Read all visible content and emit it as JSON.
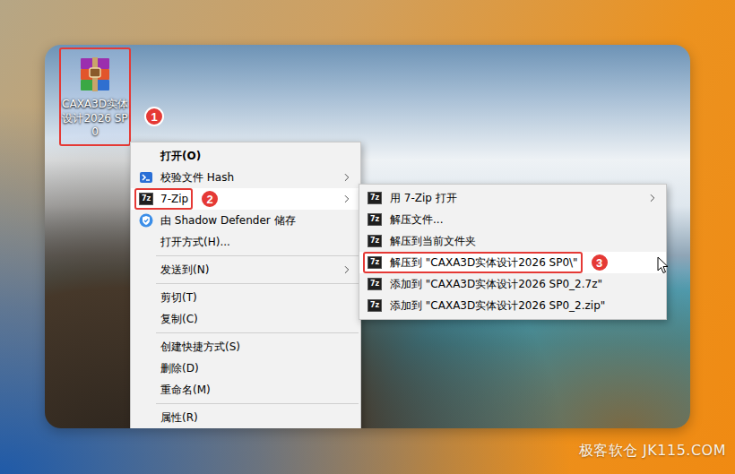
{
  "desktop": {
    "icon": {
      "label": "CAXA3D实体设计2026 SP0",
      "selected": true,
      "marked": true,
      "badge": "1"
    }
  },
  "context_menu": {
    "items": [
      {
        "label": "打开(O)",
        "kind": "plain",
        "bold": true,
        "submenu": false,
        "selected": false,
        "marked": false
      },
      {
        "label": "校验文件 Hash",
        "kind": "hash",
        "bold": false,
        "submenu": true,
        "selected": false,
        "marked": false
      },
      {
        "label": "7-Zip",
        "kind": "zip",
        "bold": false,
        "submenu": true,
        "selected": true,
        "marked": true,
        "badge": "2"
      },
      {
        "label": "由 Shadow Defender 储存",
        "kind": "shield",
        "bold": false,
        "submenu": false,
        "selected": false,
        "marked": false
      },
      {
        "label": "打开方式(H)...",
        "kind": "plain",
        "bold": false,
        "submenu": false,
        "selected": false,
        "marked": false
      },
      {
        "kind": "separator"
      },
      {
        "label": "发送到(N)",
        "kind": "plain",
        "bold": false,
        "submenu": true,
        "selected": false,
        "marked": false
      },
      {
        "kind": "separator"
      },
      {
        "label": "剪切(T)",
        "kind": "plain",
        "bold": false,
        "submenu": false,
        "selected": false,
        "marked": false
      },
      {
        "label": "复制(C)",
        "kind": "plain",
        "bold": false,
        "submenu": false,
        "selected": false,
        "marked": false
      },
      {
        "kind": "separator"
      },
      {
        "label": "创建快捷方式(S)",
        "kind": "plain",
        "bold": false,
        "submenu": false,
        "selected": false,
        "marked": false
      },
      {
        "label": "删除(D)",
        "kind": "plain",
        "bold": false,
        "submenu": false,
        "selected": false,
        "marked": false
      },
      {
        "label": "重命名(M)",
        "kind": "plain",
        "bold": false,
        "submenu": false,
        "selected": false,
        "marked": false
      },
      {
        "kind": "separator"
      },
      {
        "label": "属性(R)",
        "kind": "plain",
        "bold": false,
        "submenu": false,
        "selected": false,
        "marked": false
      }
    ]
  },
  "submenu": {
    "icon_text": "7z",
    "items": [
      {
        "label": "用 7-Zip 打开",
        "submenu": true,
        "selected": false,
        "marked": false
      },
      {
        "label": "解压文件...",
        "submenu": false,
        "selected": false,
        "marked": false
      },
      {
        "label": "解压到当前文件夹",
        "submenu": false,
        "selected": false,
        "marked": false
      },
      {
        "label": "解压到 \"CAXA3D实体设计2026 SP0\\\"",
        "submenu": false,
        "selected": true,
        "marked": true,
        "badge": "3"
      },
      {
        "label": "添加到 \"CAXA3D实体设计2026 SP0_2.7z\"",
        "submenu": false,
        "selected": false,
        "marked": false
      },
      {
        "label": "添加到 \"CAXA3D实体设计2026 SP0_2.zip\"",
        "submenu": false,
        "selected": false,
        "marked": false
      }
    ]
  },
  "watermark": "极客软仓 JK115.COM"
}
